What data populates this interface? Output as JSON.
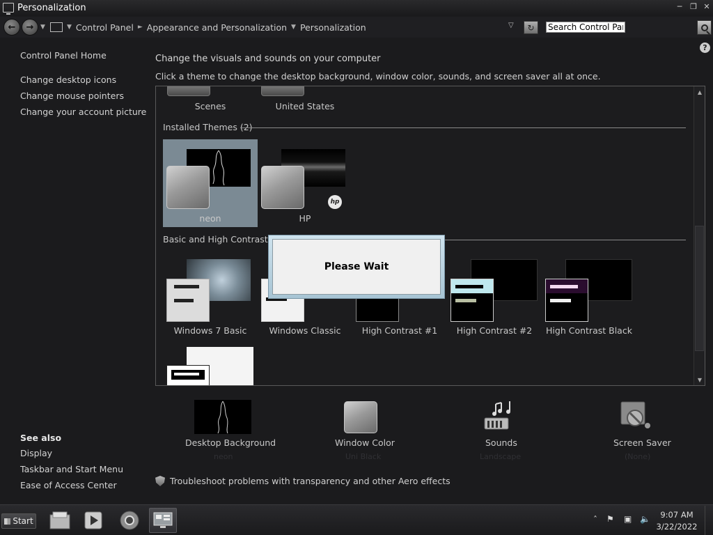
{
  "window": {
    "title": "Personalization"
  },
  "address_bar": {
    "crumbs": [
      "Control Panel",
      "Appearance and Personalization",
      "Personalization"
    ],
    "search_placeholder": "Search Control Panel"
  },
  "sidebar": {
    "home": "Control Panel Home",
    "links": [
      "Change desktop icons",
      "Change mouse pointers",
      "Change your account picture"
    ],
    "see_also_heading": "See also",
    "see_also": [
      "Display",
      "Taskbar and Start Menu",
      "Ease of Access Center"
    ]
  },
  "main": {
    "heading": "Change the visuals and sounds on your computer",
    "subheading": "Click a theme to change the desktop background, window color, sounds, and screen saver all at once."
  },
  "themes": {
    "partial_row": [
      "Scenes",
      "United States"
    ],
    "installed_heading": "Installed Themes (2)",
    "installed": [
      "neon",
      "HP"
    ],
    "hp_badge": "hp",
    "basic_heading": "Basic and High Contrast The",
    "basic": [
      "Windows 7 Basic",
      "Windows Classic",
      "High Contrast #1",
      "High Contrast #2",
      "High Contrast Black"
    ]
  },
  "dialog": {
    "message": "Please Wait"
  },
  "bottom": {
    "items": [
      {
        "label": "Desktop Background",
        "sub": "neon"
      },
      {
        "label": "Window Color",
        "sub": "Uni Black"
      },
      {
        "label": "Sounds",
        "sub": "Landscape"
      },
      {
        "label": "Screen Saver",
        "sub": "(None)"
      }
    ],
    "troubleshoot": "Troubleshoot problems with transparency and other Aero effects"
  },
  "taskbar": {
    "start_label": "Start",
    "time": "9:07 AM",
    "date": "3/22/2022"
  },
  "colors": {
    "background": "#1b1b1d",
    "selected_theme": "#7b8a94",
    "dialog_frame": "#b9d3e1"
  }
}
